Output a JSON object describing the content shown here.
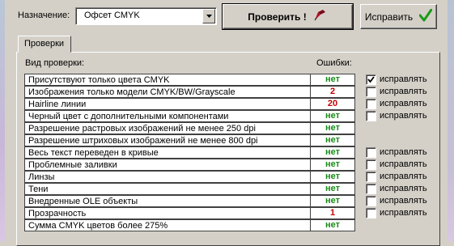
{
  "header": {
    "assign_label": "Назначение:",
    "profile_value": "Офсет CMYK",
    "verify_label": "Проверить !",
    "fix_label": "Исправить"
  },
  "tab_label": "Проверки",
  "columns": {
    "check": "Вид проверки:",
    "errors": "Ошибки:"
  },
  "checks": [
    {
      "name": "Присутствуют только цвета CMYK",
      "result": "нет",
      "status": "ok",
      "fix": "исправлять",
      "checked": true
    },
    {
      "name": "Изображения только модели CMYK/BW/Grayscale",
      "result": "2",
      "status": "bad",
      "fix": "исправлять",
      "checked": false
    },
    {
      "name": "Hairline линии",
      "result": "20",
      "status": "bad",
      "fix": "исправлять",
      "checked": false
    },
    {
      "name": "Черный цвет с дополнительными компонентами",
      "result": "нет",
      "status": "ok",
      "fix": "исправлять",
      "checked": false
    },
    {
      "name": "Разрешение растровых изображений не менее 250 dpi",
      "result": "нет",
      "status": "ok",
      "fix": null,
      "checked": false
    },
    {
      "name": "Разрешение штриховых изображений не менее 800 dpi",
      "result": "нет",
      "status": "ok",
      "fix": null,
      "checked": false
    },
    {
      "name": "Весь текст переведен в кривые",
      "result": "нет",
      "status": "ok",
      "fix": "исправлять",
      "checked": false
    },
    {
      "name": "Проблемные заливки",
      "result": "нет",
      "status": "ok",
      "fix": "исправлять",
      "checked": false
    },
    {
      "name": "Линзы",
      "result": "нет",
      "status": "ok",
      "fix": "исправлять",
      "checked": false
    },
    {
      "name": "Тени",
      "result": "нет",
      "status": "ok",
      "fix": "исправлять",
      "checked": false
    },
    {
      "name": "Внедренные OLE объекты",
      "result": "нет",
      "status": "ok",
      "fix": "исправлять",
      "checked": false
    },
    {
      "name": "Прозрачность",
      "result": "1",
      "status": "bad",
      "fix": "исправлять",
      "checked": false
    },
    {
      "name": "Сумма CMYK цветов более 275%",
      "result": "нет",
      "status": "ok",
      "fix": null,
      "checked": false
    }
  ],
  "colors": {
    "ok": "#1a8a1a",
    "bad": "#c40000",
    "face": "#d4d0c8"
  },
  "icons": {
    "verify": "pen-icon",
    "fix": "checkmark-icon",
    "dropdown": "chevron-down-icon"
  }
}
